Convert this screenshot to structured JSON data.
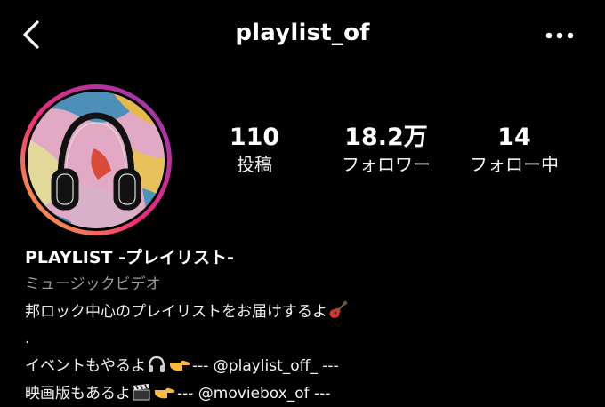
{
  "header": {
    "username": "playlist_of",
    "back_icon": "chevron-left-icon",
    "more_icon": "more-horizontal-icon"
  },
  "profile": {
    "avatar_icon": "headphones-icon",
    "story_ring_colors": [
      "#f9ce34",
      "#ee2a7b",
      "#6228d7"
    ]
  },
  "stats": {
    "posts_count": "110",
    "posts_label": "投稿",
    "followers_count": "18.2万",
    "followers_label": "フォロワー",
    "following_count": "14",
    "following_label": "フォロー中"
  },
  "bio": {
    "display_name": "PLAYLIST -プレイリスト-",
    "category": "ミュージックビデオ",
    "line1": "邦ロック中心のプレイリストをお届けするよ",
    "line1_emoji": "guitar-icon",
    "line2": ".",
    "line3_prefix": "イベントもやるよ",
    "line3_emojis": [
      "headphones-icon",
      "pointing-hand-icon"
    ],
    "line3_suffix": "--- @playlist_off_ ---",
    "line4_prefix": "映画版もあるよ",
    "line4_emojis": [
      "clapper-board-icon",
      "pointing-hand-icon"
    ],
    "line4_suffix": "--- @moviebox_of ---"
  }
}
